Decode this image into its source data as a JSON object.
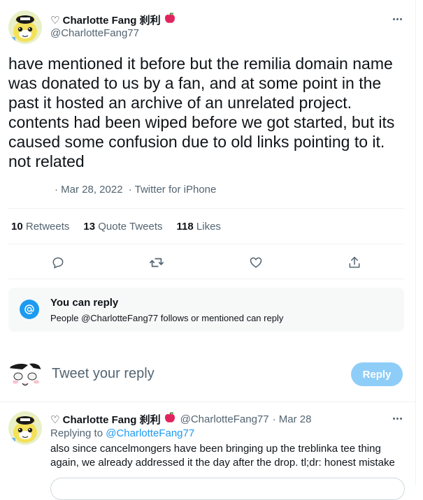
{
  "tweet": {
    "display_name": "♡ Charlotte Fang 刹利",
    "handle": "@CharlotteFang77",
    "text": "have mentioned it before but the remilia domain name\nwas donated to us by a fan, and at some point in the\npast it hosted an archive of an unrelated project.\ncontents had been wiped before we got started, but its\ncaused some confusion due to old links pointing to it.\nnot related",
    "date": "· Mar 28, 2022",
    "source": "· Twitter for iPhone"
  },
  "stats": {
    "retweets_count": "10",
    "retweets_label": "Retweets",
    "quotes_count": "13",
    "quotes_label": "Quote Tweets",
    "likes_count": "118",
    "likes_label": "Likes"
  },
  "actions": {
    "reply": "reply-icon",
    "retweet": "retweet-icon",
    "like": "heart-icon",
    "share": "share-icon"
  },
  "reply_restriction": {
    "title": "You can reply",
    "description": "People @CharlotteFang77 follows or mentioned can reply",
    "icon": "mention-icon"
  },
  "compose": {
    "placeholder": "Tweet your reply",
    "button": "Reply"
  },
  "reply_tweet": {
    "display_name": "♡ Charlotte Fang 刹利",
    "handle": "@CharlotteFang77",
    "date": "· Mar 28",
    "replying_to_label": "Replying to",
    "replying_to_handle": "@CharlotteFang77",
    "text": "also since cancelmongers have been bringing up the treblinka tee thing again, we already addressed it the day after the drop. tl;dr: honest mistake"
  },
  "colors": {
    "accent": "#1d9bf0",
    "accent_disabled": "#8ecdf8",
    "secondary_text": "#536471",
    "border": "#eff3f4",
    "apple": "#e0245e"
  }
}
